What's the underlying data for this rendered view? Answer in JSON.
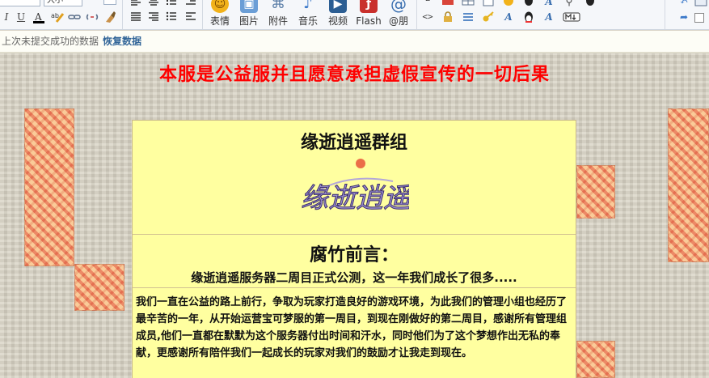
{
  "toolbar": {
    "font_size_select": "大小",
    "format_icons": [
      "italic-icon",
      "underline-icon",
      "text-color-icon",
      "link-icon",
      "unlink-icon",
      "clear-format-icon"
    ],
    "buttons": [
      {
        "label": "表情",
        "icon": "smiley-icon",
        "color": "#f2a900"
      },
      {
        "label": "图片",
        "icon": "image-icon",
        "color": "#5a8fc7"
      },
      {
        "label": "附件",
        "icon": "paperclip-icon",
        "color": "#5c7fa8"
      },
      {
        "label": "音乐",
        "icon": "music-note-icon",
        "color": "#3b78c9"
      },
      {
        "label": "视频",
        "icon": "video-icon",
        "color": "#2c5e93"
      },
      {
        "label": "Flash",
        "icon": "flash-icon",
        "color": "#c9302c"
      },
      {
        "label": "@朋",
        "icon": "at-sign-icon",
        "color": "#3a6fb0"
      }
    ]
  },
  "restore_bar": {
    "message": "上次未提交成功的数据",
    "link": "恢复数据"
  },
  "content": {
    "headline": "本服是公益服并且愿意承担虚假宣传的一切后果",
    "group_title": "缘逝逍遥群组",
    "logo_text": "缘逝逍遥",
    "preface_title": "腐竹前言：",
    "preface_subtitle": "缘逝逍遥服务器二周目正式公测，这一年我们成长了很多.....",
    "body": "我们一直在公益的路上前行，争取为玩家打造良好的游戏环境，为此我们的管理小组也经历了最辛苦的一年，从开始运营宝可梦服的第一周目，到现在刚做好的第二周目，感谢所有管理组成员,他们一直都在默默为这个服务器付出时间和汗水，同时他们为了这个梦想作出无私的奉献，更感谢所有陪伴我们一起成长的玩家对我们的鼓励才让我走到现在。"
  },
  "colors": {
    "headline": "#ff0000",
    "panel_bg": "#ffffa0",
    "link": "#336699"
  }
}
